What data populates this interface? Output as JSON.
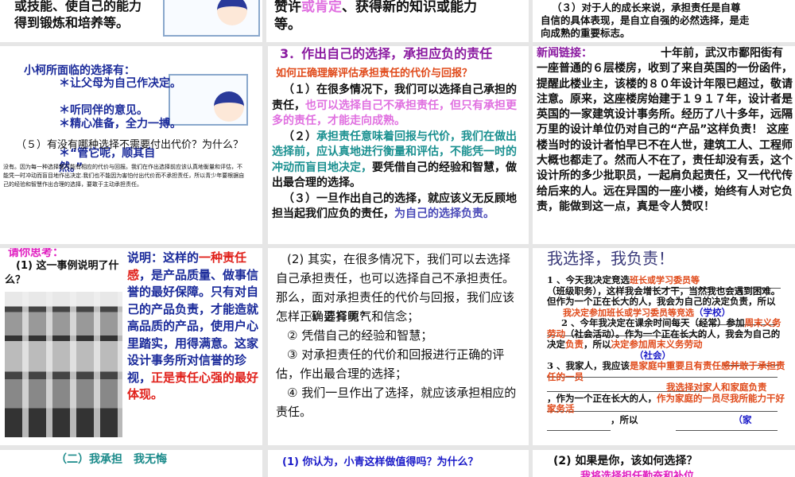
{
  "slides": {
    "s1": {
      "lines": [
        "或技能、使自己的能力",
        "得到锻炼和培养等。"
      ]
    },
    "s2": {
      "a": "赞许",
      "b": "或肯定",
      "c": "、获得新的知识或能力",
      "d": "等。"
    },
    "s3": {
      "lines": [
        "（３）对于人的成长来说，承担责任是自尊",
        "自信的具体表现，是自立自强的必然选择，是走",
        "向成熟的重要标志。"
      ]
    },
    "s4": {
      "title": "小柯所面临的选择有：",
      "opts": [
        "＊让父母为自己作决定。",
        "＊听同伴的意见。",
        "＊精心准备，全力一搏。",
        "＊“管它呢，顺其自然。”"
      ],
      "q": "（５）有没有哪种选择不需要付出代价？为什么？",
      "ans": "没有。因为每一种选择都可能有相应的代价与回报。我们在作出选择前应该认真地衡量和评估，不能凭一时冲动而盲目地作出决定.我们也不能因为害怕付出代价而不承担责任，所以青少年要根据自己的经验和智慧作出合理的选择，要敢于主动承担责任。"
    },
    "s5": {
      "title": "3．作出自己的选择，承担应负的责任",
      "sub": "如何正确理解评估承担责任的代价与回报？",
      "p1a": "（１）在很多情况下，我们可以选择自己承担的责任，",
      "p1b": "也可以选择自己不承担责任，但只有承担更多的责任，才能走向成熟。",
      "p2a": "（２）",
      "p2b": "承担责任意味着回报与代价，我们在做出选择前，应认真地进行衡量和评估，不能凭一时的冲动而盲目地决定，",
      "p2c": "要凭借自己的经验和智慧，做出最合理的选择。",
      "p3a": "（３）一旦作出自己的选择，就应该义无反顾地担当起我们应负的责任，",
      "p3b": "为自己的选择负责。"
    },
    "s6": {
      "label": "新闻链接：",
      "text": "十年前，武汉市鄱阳街有一座普通的６层楼房，收到了来自英国的一份函件，提醒此楼业主，该楼的８０年设计年限已超过，敬请注意。原来，这座楼房始建于１９１７年，设计者是英国的一家建筑设计事务所。经历了八十多年，远隔万里的设计单位仍对自己的“产品”这样负责！ 这座楼当时的设计者怕早已不在人世，建筑工人、工程师大概也都走了。然而人不在了，责任却没有丢，这个设计所的多少批职员，一起肩负起责任，又一代代传给后来的人。远在异国的一座小楼，始终有人对它负责，能做到这一点，真是令人赞叹！"
    },
    "s7": {
      "label": "请你思考：",
      "q": "(1) 这一事例说明了什么？",
      "a": "说明：这样的",
      "b": "一种责任感",
      "c": "，是产品质量、做事信誉的最好保障。只有对自己的产品负责，才能造就高品质的产品，使用户心里踏实，用得满意。这家设计事务所对信誉的珍视，",
      "d": "正是责任心强的最好体现。"
    },
    "s8": {
      "p": "(2) 其实，在很多情况下，我们可以去选择自己承担责任，也可以选择自己不承担责任。那么，面对承担责任的代价与回报，我们应该怎样正确选择呢?",
      "items": [
        "① 要有勇气和信念；",
        "② 凭借自己的经验和智慧；",
        "③ 对承担责任的代价和回报进行正确的评估，作出最合理的选择；",
        "④ 我们一旦作出了选择，就应该承担相应的责任。"
      ]
    },
    "s9": {
      "title": "我选择，我负责！",
      "l1": "1 、今天我决定竞选",
      "f1": "班长或学习委员等",
      "l2": "（班级职务），这样我会增长才干，当然我也会遇到困难。但作为一个正在长大的人，我会为自己的决定负责，所以",
      "f2": "我决定参加班长或学习委员等竞选",
      "tag1": "（学校）",
      "l3": "2 、今年我决定在课余时间每天（经常）参加",
      "f3": "周末义务劳动",
      "l4": "（社会活动）。作为一个正在长大的人，我会为自己的决定",
      "f4": "负责",
      "l5": "，所以",
      "f5": "决定参加周末义务劳动",
      "tag2": "（社会）",
      "l6": "3 、我家人，我应该",
      "f6": "是家庭中重要且有责任感并敢于承担责任的一员",
      "f7": "我选择对家人和家庭负责",
      "l7": "，作为一个正在长大的人，",
      "f8": "作为家庭的一员尽我所能力干好家务活",
      "l8": "，所以",
      "tag3": "（家"
    },
    "s10": {
      "title": "（二）我承担　我无悔"
    },
    "s11": {
      "q": "(1) 你认为，小青这样做值得吗？为什么？"
    },
    "s12": {
      "q": "(2) 如果是你，该如何选择？",
      "a": "我将选择担任勤奋和补位"
    }
  }
}
